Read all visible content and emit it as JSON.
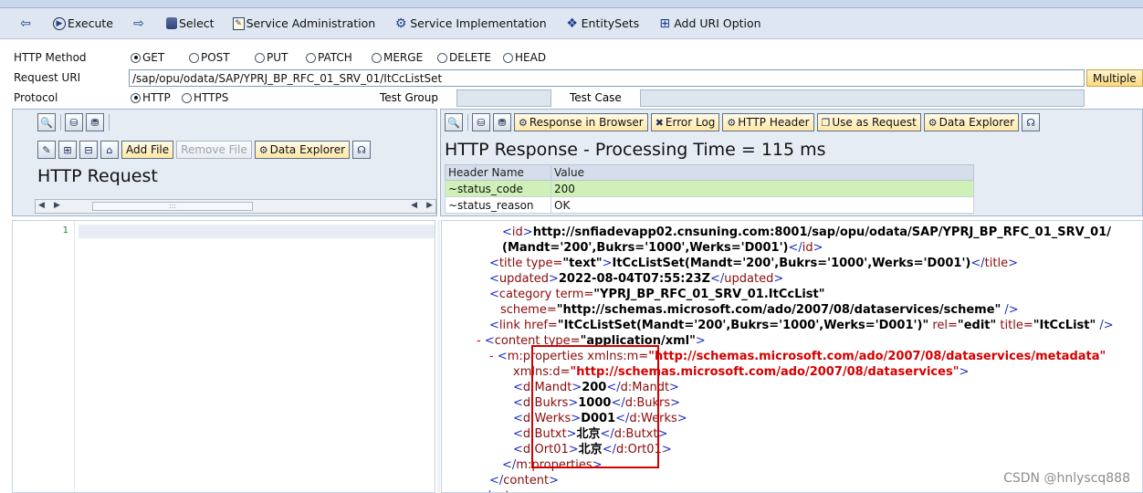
{
  "toolbar": {
    "items": [
      {
        "icon": "back-arrow-icon",
        "label": ""
      },
      {
        "icon": "execute-icon",
        "label": "Execute"
      },
      {
        "icon": "select-arrow-icon",
        "label": ""
      },
      {
        "icon": "database-icon",
        "label": "Select"
      },
      {
        "icon": "service-admin-icon",
        "label": "Service Administration"
      },
      {
        "icon": "service-impl-icon",
        "label": "Service Implementation"
      },
      {
        "icon": "entitysets-icon",
        "label": "EntitySets"
      },
      {
        "icon": "add-uri-icon",
        "label": "Add URI Option"
      }
    ]
  },
  "form": {
    "http_method_label": "HTTP Method",
    "methods": [
      "GET",
      "POST",
      "PUT",
      "PATCH",
      "MERGE",
      "DELETE",
      "HEAD"
    ],
    "selected_method": "GET",
    "request_uri_label": "Request URI",
    "request_uri": "/sap/opu/odata/SAP/YPRJ_BP_RFC_01_SRV_01/ItCcListSet",
    "multiple_label": "Multiple",
    "protocol_label": "Protocol",
    "protocols": [
      "HTTP",
      "HTTPS"
    ],
    "selected_protocol": "HTTP",
    "test_group_label": "Test Group",
    "test_group_value": "",
    "test_case_label": "Test Case",
    "test_case_value": ""
  },
  "request_pane": {
    "add_file": "Add File",
    "remove_file": "Remove File",
    "data_explorer": "Data Explorer",
    "title": "HTTP Request",
    "line_number": "1"
  },
  "response_pane": {
    "response_in_browser": "Response in Browser",
    "error_log": "Error Log",
    "http_header": "HTTP Header",
    "use_as_request": "Use as Request",
    "data_explorer": "Data Explorer",
    "title": "HTTP Response - Processing Time = 115  ms",
    "header_cols": [
      "Header Name",
      "Value"
    ],
    "headers": [
      {
        "name": "~status_code",
        "value": "200"
      },
      {
        "name": "~status_reason",
        "value": "OK"
      }
    ]
  },
  "xml": {
    "id_url": "http://snfiadevapp02.cnsuning.com:8001/sap/opu/odata/SAP/YPRJ_BP_RFC_01_SRV_01/",
    "id_key": "(Mandt='200',Bukrs='1000',Werks='D001')",
    "title_type": "\"text\"",
    "title_text": "ItCcListSet(Mandt='200',Bukrs='1000',Werks='D001')",
    "updated": "2022-08-04T07:55:23Z",
    "category_term": "\"YPRJ_BP_RFC_01_SRV_01.ItCcList\"",
    "category_scheme": "\"http://schemas.microsoft.com/ado/2007/08/dataservices/scheme\"",
    "link_href": "\"ItCcListSet(Mandt='200',Bukrs='1000',Werks='D001')\"",
    "link_rel": "\"edit\"",
    "link_title": "\"ItCcList\"",
    "content_type": "\"application/xml\"",
    "ns_m": "\"http://schemas.microsoft.com/ado/2007/08/dataservices/metadata\"",
    "ns_d": "\"http://schemas.microsoft.com/ado/2007/08/dataservices\"",
    "mandt": "200",
    "bukrs": "1000",
    "werks": "D001",
    "butxt": "北京",
    "ort01": "北京"
  },
  "watermark": "CSDN @hnlyscq888"
}
